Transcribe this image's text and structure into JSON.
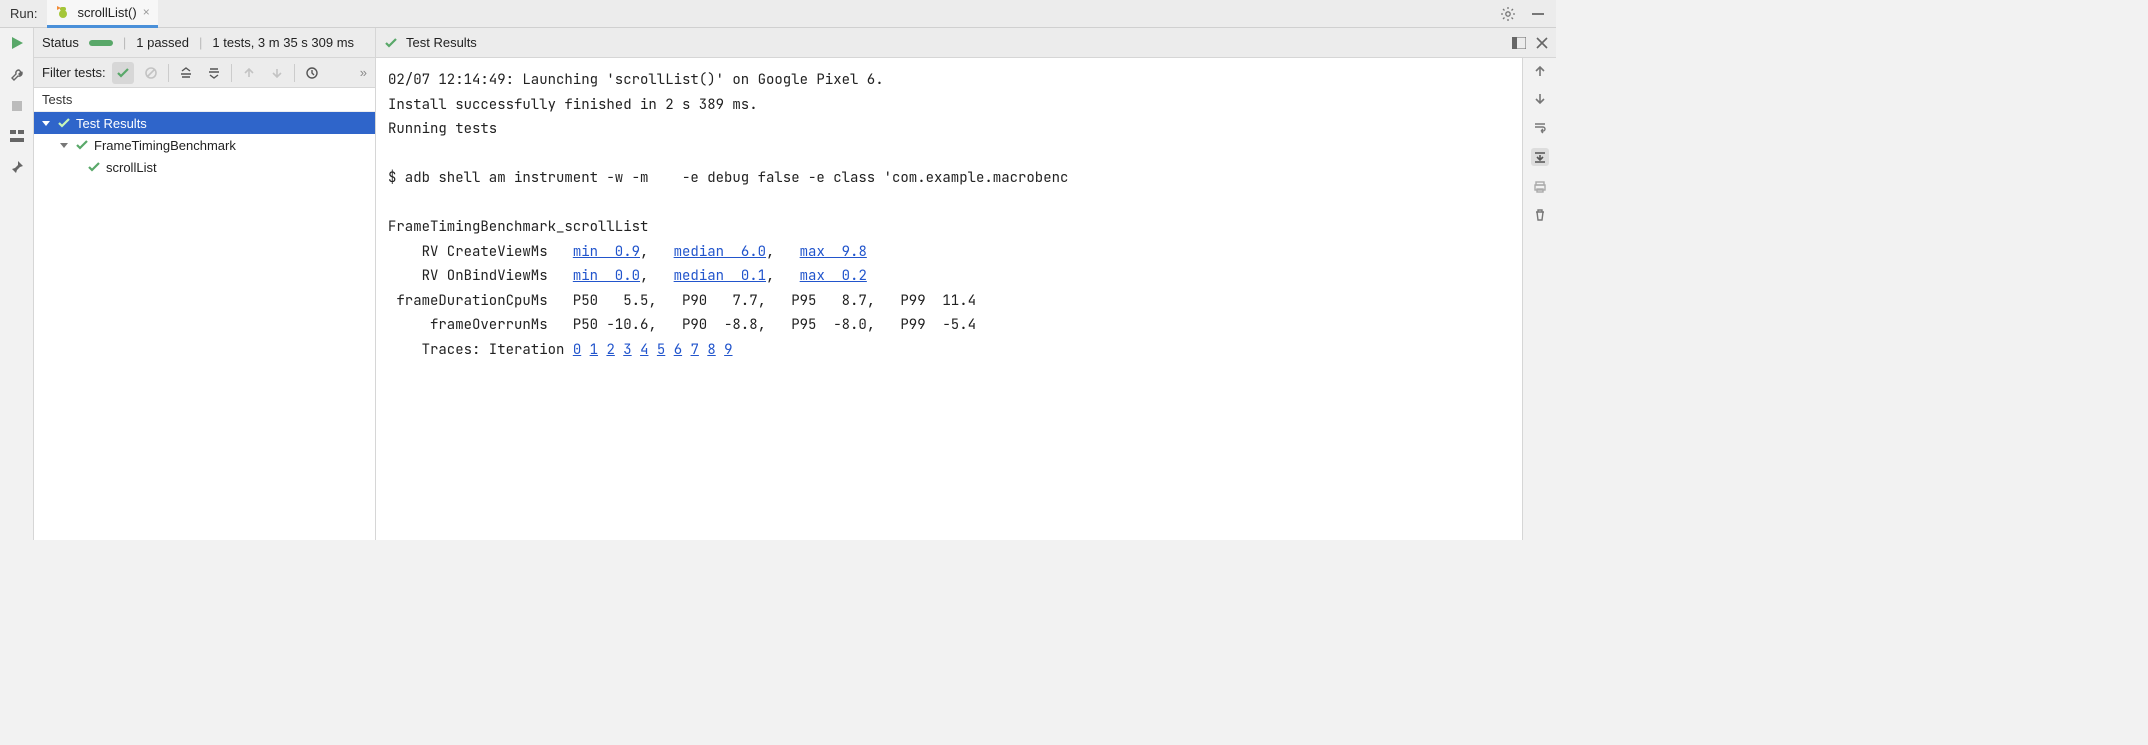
{
  "tabbar": {
    "run_label": "Run:",
    "tab_name": "scrollList()",
    "close_glyph": "×"
  },
  "status": {
    "label": "Status",
    "passed": "1 passed",
    "summary": "1 tests, 3 m 35 s 309 ms"
  },
  "filter": {
    "label": "Filter tests:",
    "overflow": "»"
  },
  "tree": {
    "header": "Tests",
    "root": "Test Results",
    "class": "FrameTimingBenchmark",
    "method": "scrollList"
  },
  "right": {
    "header": "Test Results"
  },
  "console": {
    "l1": "02/07 12:14:49: Launching 'scrollList()' on Google Pixel 6.",
    "l2": "Install successfully finished in 2 s 389 ms.",
    "l3": "Running tests",
    "l4": "",
    "l5": "$ adb shell am instrument -w -m    -e debug false -e class 'com.example.macrobenc",
    "l6": "",
    "l7": "FrameTimingBenchmark_scrollList",
    "rv_create": {
      "label": "    RV CreateViewMs   ",
      "min": "min  0.9",
      "c1": ",   ",
      "median": "median  6.0",
      "c2": ",   ",
      "max": "max  9.8"
    },
    "rv_bind": {
      "label": "    RV OnBindViewMs   ",
      "min": "min  0.0",
      "c1": ",   ",
      "median": "median  0.1",
      "c2": ",   ",
      "max": "max  0.2"
    },
    "cpu": " frameDurationCpuMs   P50   5.5,   P90   7.7,   P95   8.7,   P99  11.4",
    "overrun": "     frameOverrunMs   P50 -10.6,   P90  -8.8,   P95  -8.0,   P99  -5.4",
    "traces_label": "    Traces: Iteration ",
    "traces": [
      "0",
      "1",
      "2",
      "3",
      "4",
      "5",
      "6",
      "7",
      "8",
      "9"
    ]
  },
  "chart_data": {
    "type": "table",
    "title": "FrameTimingBenchmark_scrollList",
    "metrics": [
      {
        "name": "RV CreateViewMs",
        "min": 0.9,
        "median": 6.0,
        "max": 9.8
      },
      {
        "name": "RV OnBindViewMs",
        "min": 0.0,
        "median": 0.1,
        "max": 0.2
      },
      {
        "name": "frameDurationCpuMs",
        "P50": 5.5,
        "P90": 7.7,
        "P95": 8.7,
        "P99": 11.4
      },
      {
        "name": "frameOverrunMs",
        "P50": -10.6,
        "P90": -8.8,
        "P95": -8.0,
        "P99": -5.4
      }
    ]
  }
}
